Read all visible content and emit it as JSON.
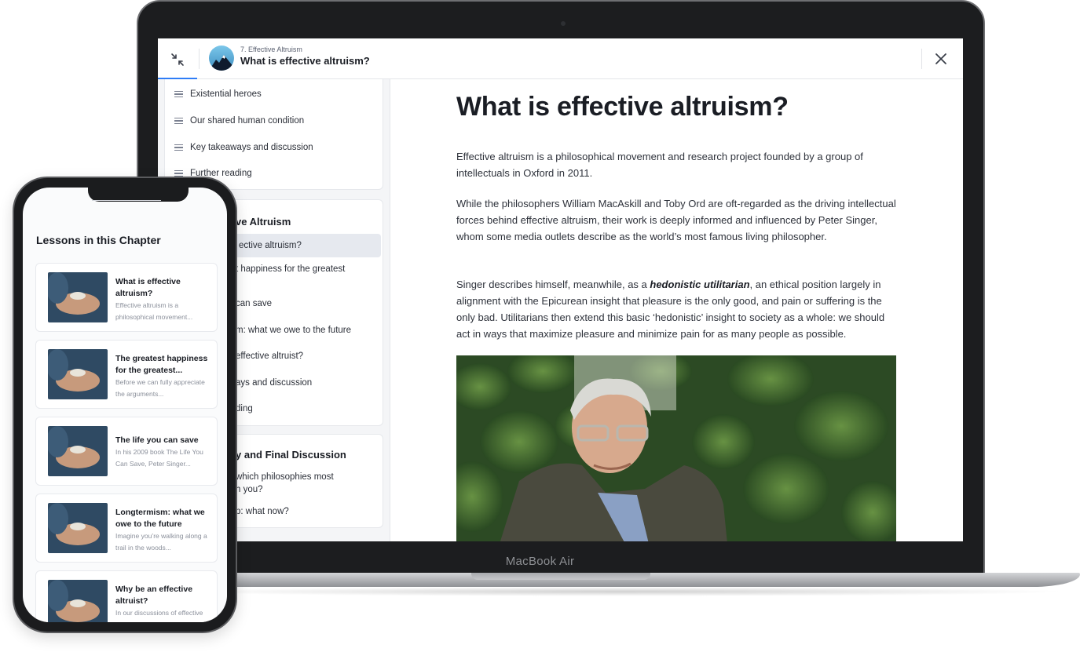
{
  "laptop": {
    "brand_label": "MacBook Air",
    "topbar": {
      "chapter": "7. Effective Altruism",
      "lesson_title": "What is effective altruism?",
      "icons": {
        "collapse": "collapse-arrows-icon",
        "close": "close-icon",
        "logo": "mountain-logo-icon"
      }
    },
    "sidebar": {
      "prev_chapter_items": [
        "Existential heroes",
        "Our shared human condition",
        "Key takeaways and discussion",
        "Further reading"
      ],
      "current_chapter": {
        "title": "ve Altruism",
        "items": [
          "ective altruism?",
          "t happiness for the greatest",
          "can save",
          "m: what we owe to the future",
          "effective altruist?",
          "ays and discussion",
          "ding"
        ]
      },
      "next_chapter": {
        "title": "y and Final Discussion",
        "items": [
          "which philosophies most",
          "h you?",
          "p: what now?"
        ]
      }
    },
    "article": {
      "title": "What is effective altruism?",
      "p1": "Effective altruism is a philosophical movement and research project founded by a group of intellectuals in Oxford in 2011.",
      "p2": "While the philosophers William MacAskill and Toby Ord are oft-regarded as the driving intellectual forces behind effective altruism, their work is deeply informed and influenced by Peter Singer, whom some media outlets describe as the world’s most famous living philosopher.",
      "p3_before": "Singer describes himself, meanwhile, as a ",
      "p3_emph": "hedonistic utilitarian",
      "p3_after": ", an ethical position largely in alignment with the Epicurean insight that pleasure is the only good, and pain or suffering is the only bad. Utilitarians then extend this basic ‘hedonistic’ insight to society as a whole: we should act in ways that maximize pleasure and minimize pain for as many people as possible."
    }
  },
  "phone": {
    "heading": "Lessons in this Chapter",
    "lessons": [
      {
        "title": "What is effective altruism?",
        "snippet": "Effective altruism is a philosophical movement..."
      },
      {
        "title": "The greatest happiness for the greatest...",
        "snippet": "Before we can fully appreciate the arguments..."
      },
      {
        "title": "The life you can save",
        "snippet": "In his 2009 book The Life You Can Save, Peter Singer..."
      },
      {
        "title": "Longtermism: what we owe to the future",
        "snippet": "Imagine you’re walking along a trail in the woods..."
      },
      {
        "title": "Why be an effective altruist?",
        "snippet": "In our discussions of effective altruism so far, we..."
      }
    ]
  },
  "colors": {
    "accent": "#2f7df6",
    "text": "#1a1d24"
  }
}
